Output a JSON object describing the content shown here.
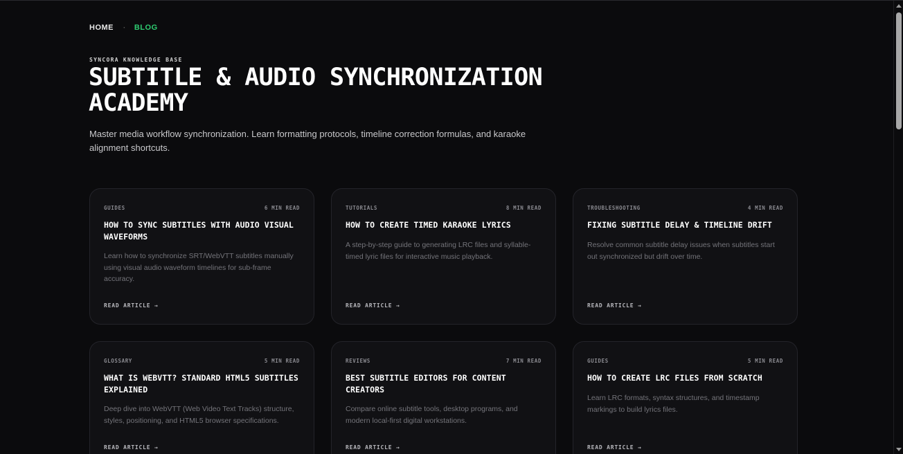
{
  "breadcrumb": {
    "home": "HOME",
    "separator": "·",
    "current": "BLOG"
  },
  "hero": {
    "eyebrow": "SYNCORA KNOWLEDGE BASE",
    "title": "SUBTITLE & AUDIO SYNCHRONIZATION ACADEMY",
    "lead": "Master media workflow synchronization. Learn formatting protocols, timeline correction formulas, and karaoke alignment shortcuts."
  },
  "cards": [
    {
      "category": "GUIDES",
      "read_time": "6 MIN READ",
      "title": "HOW TO SYNC SUBTITLES WITH AUDIO VISUAL WAVEFORMS",
      "excerpt": "Learn how to synchronize SRT/WebVTT subtitles manually using visual audio waveform timelines for sub-frame accuracy.",
      "cta": "READ ARTICLE →"
    },
    {
      "category": "TUTORIALS",
      "read_time": "8 MIN READ",
      "title": "HOW TO CREATE TIMED KARAOKE LYRICS",
      "excerpt": "A step-by-step guide to generating LRC files and syllable-timed lyric files for interactive music playback.",
      "cta": "READ ARTICLE →"
    },
    {
      "category": "TROUBLESHOOTING",
      "read_time": "4 MIN READ",
      "title": "FIXING SUBTITLE DELAY & TIMELINE DRIFT",
      "excerpt": "Resolve common subtitle delay issues when subtitles start out synchronized but drift over time.",
      "cta": "READ ARTICLE →"
    },
    {
      "category": "GLOSSARY",
      "read_time": "5 MIN READ",
      "title": "WHAT IS WEBVTT? STANDARD HTML5 SUBTITLES EXPLAINED",
      "excerpt": "Deep dive into WebVTT (Web Video Text Tracks) structure, styles, positioning, and HTML5 browser specifications.",
      "cta": "READ ARTICLE →"
    },
    {
      "category": "REVIEWS",
      "read_time": "7 MIN READ",
      "title": "BEST SUBTITLE EDITORS FOR CONTENT CREATORS",
      "excerpt": "Compare online subtitle tools, desktop programs, and modern local-first digital workstations.",
      "cta": "READ ARTICLE →"
    },
    {
      "category": "GUIDES",
      "read_time": "5 MIN READ",
      "title": "HOW TO CREATE LRC FILES FROM SCRATCH",
      "excerpt": "Learn LRC formats, syntax structures, and timestamp markings to build lyrics files.",
      "cta": "READ ARTICLE →"
    }
  ],
  "colors": {
    "background": "#0b0b0d",
    "accent": "#2ecc71",
    "card": "#111114"
  }
}
